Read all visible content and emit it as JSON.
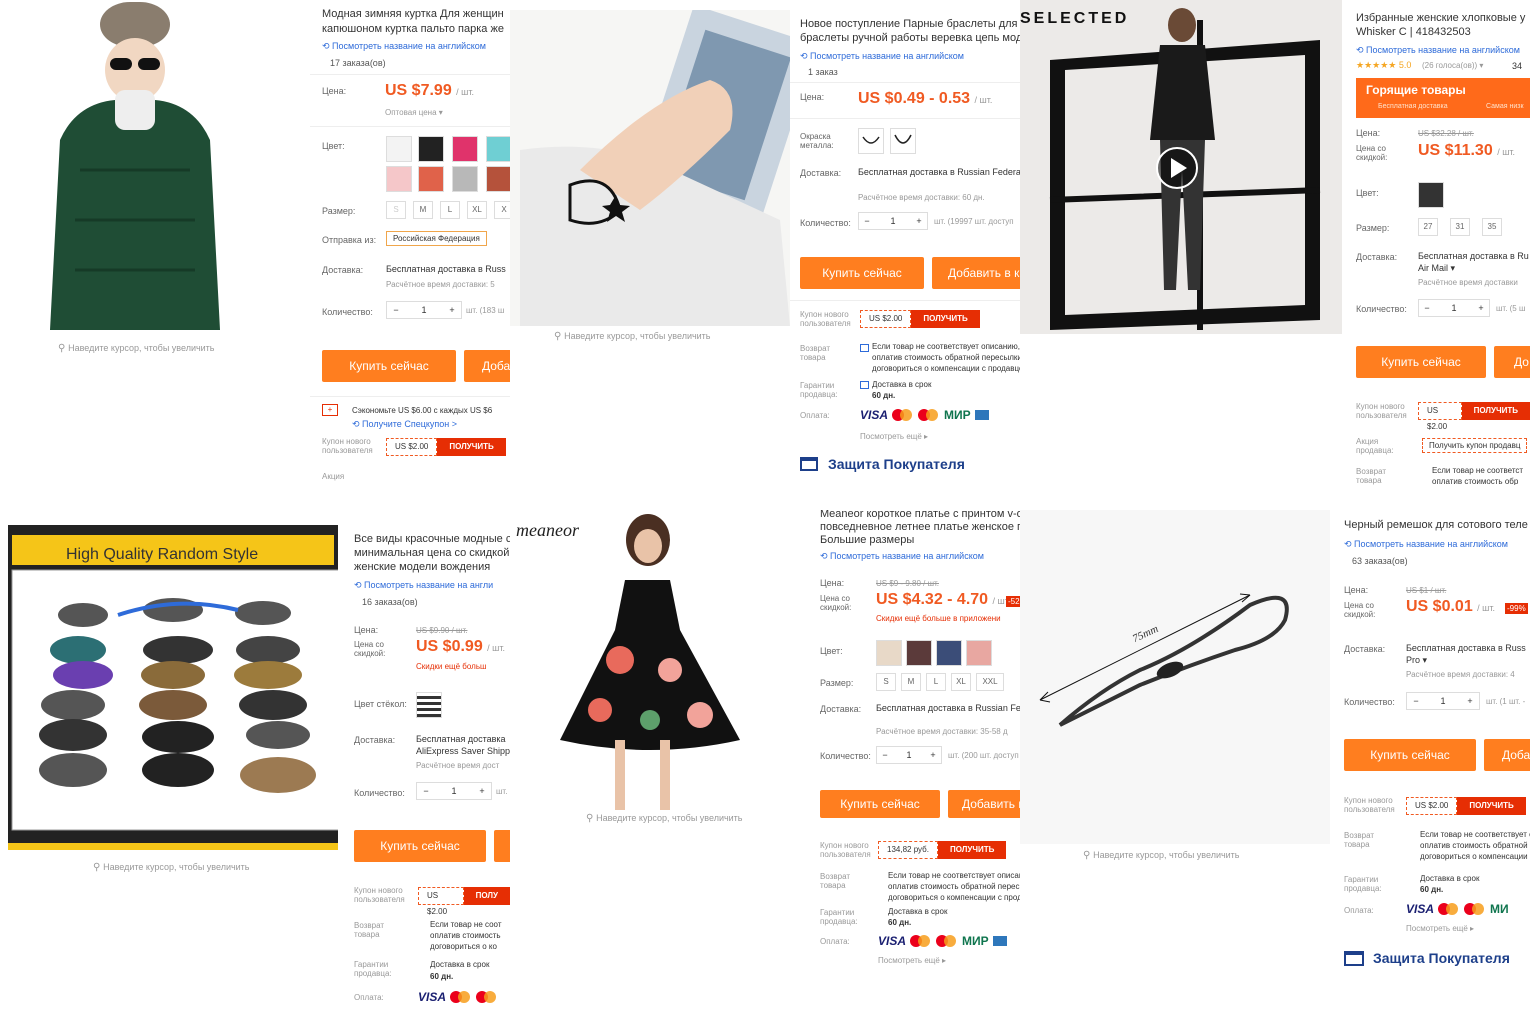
{
  "common": {
    "hover_hint": "Наведите курсор, чтобы увеличить",
    "view_english": "Посмотреть название на английском",
    "price_label": "Цена:",
    "discount_price_label": "Цена со скидкой:",
    "color_label": "Цвет:",
    "size_label": "Размер:",
    "ship_from_label": "Отправка из:",
    "delivery_label": "Доставка:",
    "quantity_label": "Количество:",
    "buy_now": "Купить сейчас",
    "add_to_cart": "Добавить в корзину",
    "new_user_coupon_label": "Купон нового пользователя",
    "get_button": "ПОЛУЧИТЬ",
    "return_label": "Возврат товара",
    "seller_guarantee_label": "Гарантии продавца:",
    "payment_label": "Оплата:",
    "see_more": "Посмотреть ещё ▸",
    "buyer_protection": "Защита Покупателя",
    "unit": "/ шт.",
    "minus": "−",
    "plus": "+",
    "qty_value": "1",
    "free_delivery_russia": "Бесплатная доставка в Russian Federation",
    "delivery_time": "Расчётное время доставки:",
    "return_text_1": "Если товар не соответствует описанию,",
    "return_text_2": "оплатив стоимость обратной пересылки",
    "return_text_3": "договориться о компенсации с продавцом",
    "delivery_on_time": "Доставка в срок",
    "days_60": "60 дн.",
    "promo_label": "Акция продавца:",
    "get_coupon_promo": "Получить купон продавца",
    "payment_methods": [
      "VISA",
      "MasterCard",
      "Maestro",
      "МИР",
      "AmEx"
    ]
  },
  "products": [
    {
      "id": "jacket",
      "title_1": "Модная зимняя куртка Для женщин",
      "title_2": "капюшоном куртка пальто парка же",
      "orders": "17 заказа(ов)",
      "price": "US $7.99",
      "wholesale": "Оптовая цена ▾",
      "sizes": [
        "S",
        "M",
        "L",
        "XL",
        "X"
      ],
      "ship_from": "Российская Федерация",
      "delivery": "Бесплатная доставка в Russ",
      "delivery_time": "Расчётное время доставки: 5",
      "stock": "шт. (183 ш",
      "add_to_cart": "Доба",
      "save_text": "Сэкономьте US $6.00 с каждых US $6",
      "get_special": "Получите Спецкупон >",
      "coupon": "US $2.00",
      "promo": "Акция"
    },
    {
      "id": "bracelet",
      "title_1": "Новое поступление Парные браслеты для же",
      "title_2": "браслеты ручной работы веревка цепь мода",
      "orders": "1 заказ",
      "price": "US $0.49 - 0.53",
      "metal_color_label": "Окраска металла:",
      "delivery": "Бесплатная доставка в Russian Federa",
      "delivery_time": "Расчётное время доставки: 60 дн.",
      "stock": "шт. (19997 шт. доступ",
      "add_to_cart": "Добавить в к",
      "coupon": "US $2.00"
    },
    {
      "id": "coat",
      "brand_overlay": "SELECTED",
      "title_1": "Избранные женские хлопковые у",
      "title_2": "Whisker C | 418432503",
      "rating": "★★★★★ 5.0",
      "rating_count": "(26 голоса(ов)) ▾",
      "rating_extra": "34",
      "hot_deals": "Горящие товары",
      "hot_sub_1": "Бесплатная доставка",
      "hot_sub_2": "Самая низк",
      "old_price": "US $32.28 / шт.",
      "price": "US $11.30",
      "sizes": [
        "27",
        "31",
        "35"
      ],
      "delivery": "Бесплатная доставка в Ru",
      "delivery_method": "Air Mail ▾",
      "delivery_time": "Расчётное время доставки",
      "stock": "шт. (5 ш",
      "add_to_cart": "До",
      "coupon": "US $2.00",
      "promo_coupon": "Получить купон продавц",
      "return_text": "Если товар не соответст",
      "return_text_2": "оплатив стоимость обр"
    },
    {
      "id": "sunglasses",
      "banner": "High Quality Random Style",
      "title_1": "Все виды красочные модные с",
      "title_2": "минимальная цена со скидкой",
      "title_3": "женские модели вождения",
      "view_english": "Посмотреть название на англи",
      "orders": "16 заказа(ов)",
      "old_price": "US $9.90 / шт.",
      "price": "US $0.99",
      "app_discount": "Скидки ещё больш",
      "lens_color_label": "Цвет стёкол:",
      "delivery": "Бесплатная доставка",
      "delivery_method": "AliExpress Saver Shipp",
      "delivery_time": "Расчётное время дост",
      "stock": "шт.",
      "coupon": "US $2.00",
      "get_button": "ПОЛУ",
      "return_text_1": "Если товар не соот",
      "return_text_2": "оплатив стоимость",
      "return_text_3": "договориться о ко"
    },
    {
      "id": "dress",
      "brand_logo": "meaneor",
      "title_1": "Meaneor короткое платье с принтом v-обр",
      "title_2": "повседневное летнее платье женское пля",
      "title_3": "Большие размеры",
      "old_price": "US $9 - 9.80 / шт.",
      "price": "US $4.32 - 4.70",
      "discount_badge": "-52",
      "app_discount": "Скидки ещё больше в приложени",
      "sizes": [
        "S",
        "M",
        "L",
        "XL",
        "XXL"
      ],
      "delivery": "Бесплатная доставка в Russian Fede",
      "delivery_time": "Расчётное время доставки: 35-58 д",
      "stock": "шт. (200 шт. доступ",
      "add_to_cart": "Добавить в",
      "coupon": "134,82 руб."
    },
    {
      "id": "strap",
      "dimension": "75mm",
      "title_1": "Черный ремешок для сотового теле",
      "orders": "63 заказа(ов)",
      "old_price": "US $1 / шт.",
      "price": "US $0.01",
      "discount_badge": "-99%",
      "delivery": "Бесплатная доставка в Russ",
      "delivery_method": "Pro ▾",
      "delivery_time": "Расчётное время доставки: 4",
      "stock": "шт. (1 шт. -",
      "add_to_cart": "Доба",
      "coupon": "US $2.00"
    }
  ]
}
